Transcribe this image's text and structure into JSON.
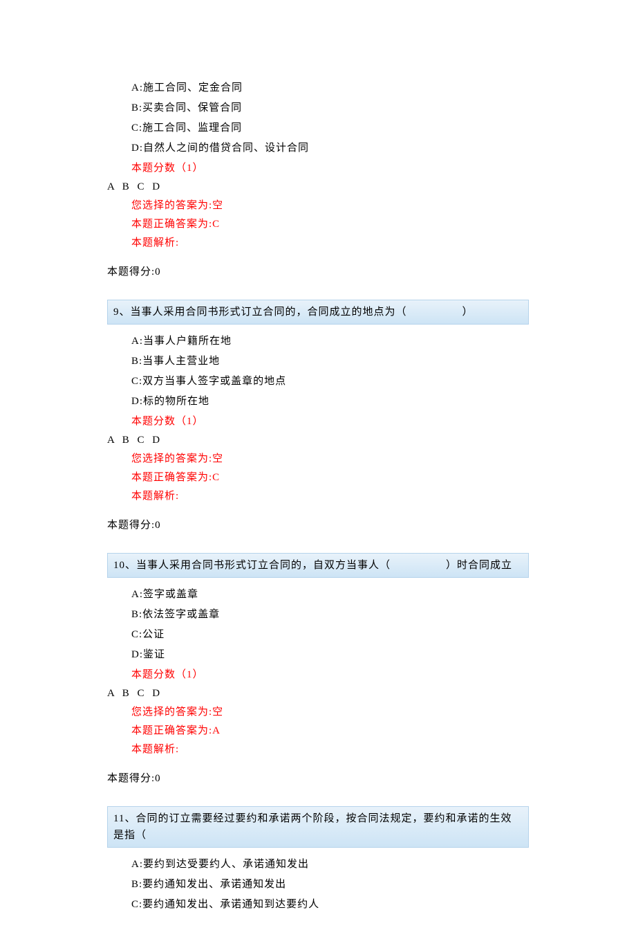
{
  "q8": {
    "opts": {
      "a": "A:施工合同、定金合同",
      "b": "B:买卖合同、保管合同",
      "c": "C:施工合同、监理合同",
      "d": "D:自然人之间的借贷合同、设计合同"
    },
    "score_label": "本题分数（1）",
    "abcd": "A B C D",
    "selected": "您选择的答案为:空",
    "correct": "本题正确答案为:C",
    "explain": "本题解析:",
    "earned": "本题得分:0"
  },
  "q9": {
    "header": "9、当事人采用合同书形式订立合同的，合同成立的地点为（　　　　　）",
    "opts": {
      "a": "A:当事人户籍所在地",
      "b": "B:当事人主营业地",
      "c": "C:双方当事人签字或盖章的地点",
      "d": "D:标的物所在地"
    },
    "score_label": "本题分数（1）",
    "abcd": "A B C D",
    "selected": "您选择的答案为:空",
    "correct": "本题正确答案为:C",
    "explain": "本题解析:",
    "earned": "本题得分:0"
  },
  "q10": {
    "header": "10、当事人采用合同书形式订立合同的，自双方当事人（　　　　　）时合同成立",
    "opts": {
      "a": "A:签字或盖章",
      "b": "B:依法签字或盖章",
      "c": "C:公证",
      "d": "D:鉴证"
    },
    "score_label": "本题分数（1）",
    "abcd": "A B C D",
    "selected": "您选择的答案为:空",
    "correct": "本题正确答案为:A",
    "explain": "本题解析:",
    "earned": "本题得分:0"
  },
  "q11": {
    "header": "11、合同的订立需要经过要约和承诺两个阶段，按合同法规定，要约和承诺的生效是指（",
    "opts": {
      "a": "A:要约到达受要约人、承诺通知发出",
      "b": "B:要约通知发出、承诺通知发出",
      "c": "C:要约通知发出、承诺通知到达要约人"
    }
  }
}
